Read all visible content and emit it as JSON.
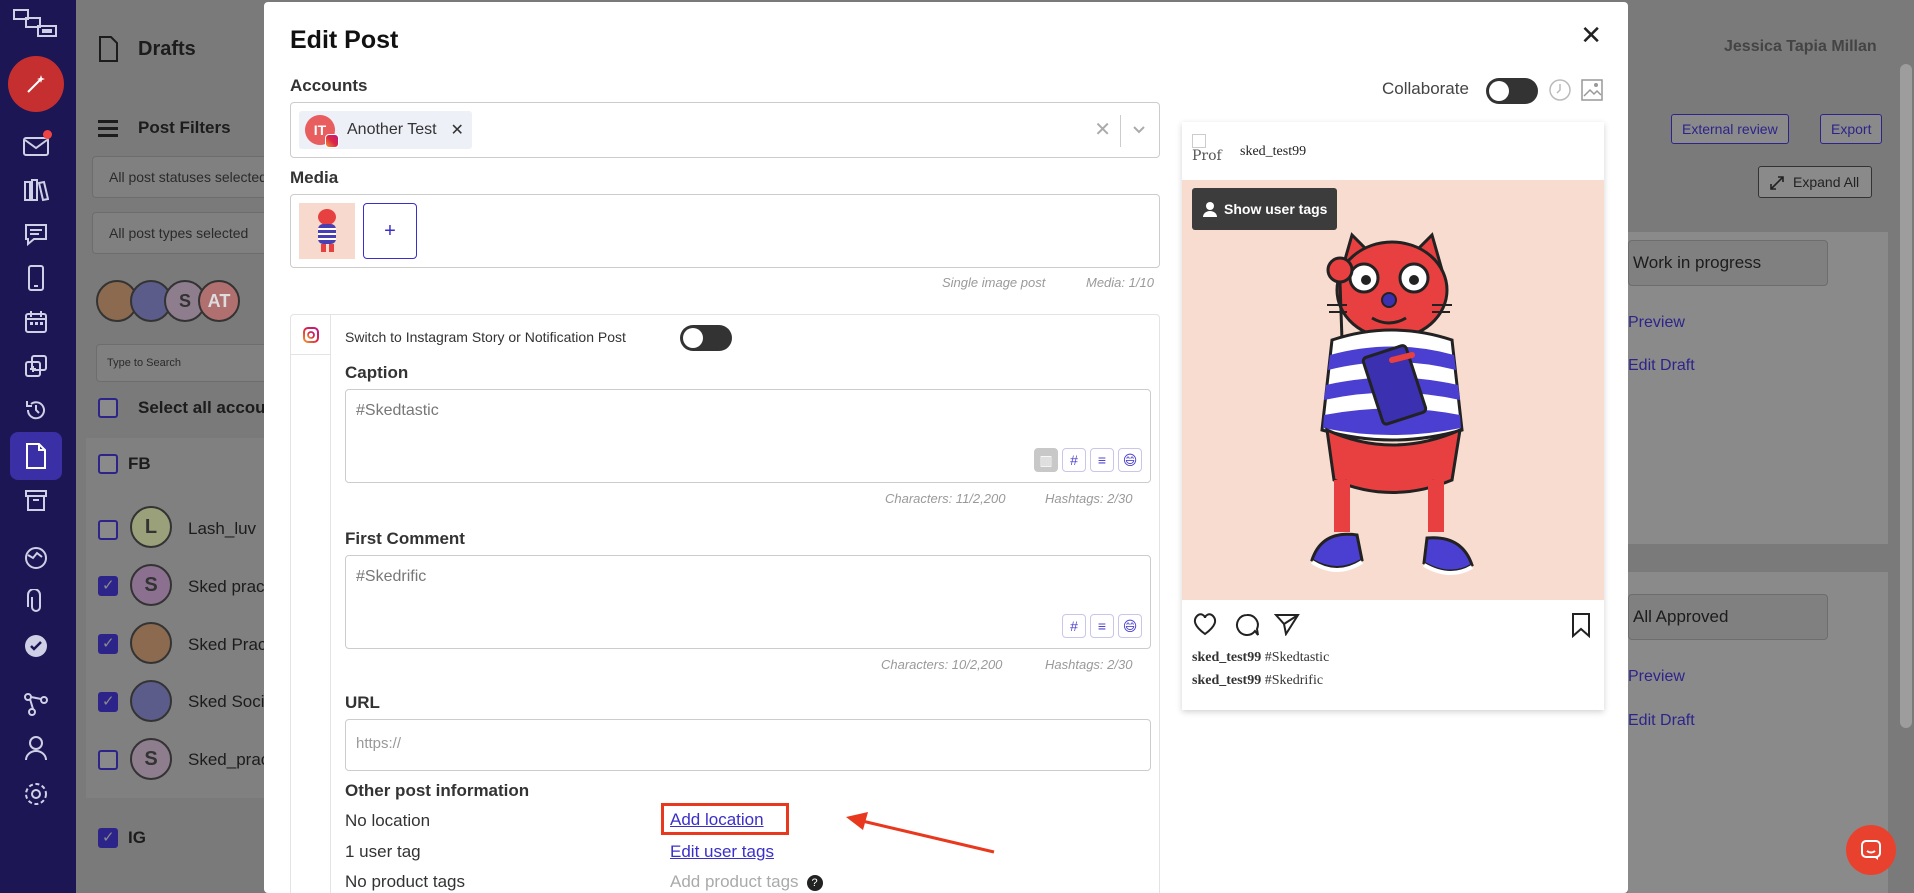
{
  "background": {
    "page_title": "Drafts",
    "user_name": "Jessica Tapia Millan",
    "post_filters_label": "Post Filters",
    "status_filter": "All post statuses selected",
    "type_filter": "All post types selected",
    "search_placeholder": "Type to Search",
    "select_all_label": "Select all accounts",
    "groups": [
      {
        "name": "FB"
      },
      {
        "name": "IG"
      }
    ],
    "accounts": [
      {
        "name": "Lash_luv",
        "initial": "L",
        "checked": false
      },
      {
        "name": "Sked practice",
        "initial": "S",
        "checked": true
      },
      {
        "name": "Sked Practice",
        "initial": "",
        "checked": true
      },
      {
        "name": "Sked Social",
        "initial": "",
        "checked": true
      },
      {
        "name": "Sked_practice",
        "initial": "S",
        "checked": false
      }
    ],
    "external_review": "External review",
    "export": "Export",
    "expand_all": "Expand All",
    "status_1": "Work in progress",
    "status_2": "All Approved",
    "preview_link": "Preview",
    "edit_draft_link": "Edit Draft"
  },
  "modal": {
    "title": "Edit Post",
    "accounts_label": "Accounts",
    "account_chip": {
      "initials": "IT",
      "name": "Another Test"
    },
    "media_label": "Media",
    "media_add": "+",
    "media_hint_type": "Single image post",
    "media_hint_count": "Media: 1/10",
    "switch_label": "Switch to Instagram Story or Notification Post",
    "caption_label": "Caption",
    "caption_value": "#Skedtastic",
    "caption_chars": "Characters: 11/2,200",
    "caption_hashtags": "Hashtags: 2/30",
    "first_comment_label": "First Comment",
    "first_comment_value": "#Skedrific",
    "comment_chars": "Characters: 10/2,200",
    "comment_hashtags": "Hashtags: 2/30",
    "url_label": "URL",
    "url_placeholder": "https://",
    "other_info_label": "Other post information",
    "location_status": "No location",
    "location_link": "Add location",
    "user_tag_status": "1 user tag",
    "user_tag_link": "Edit user tags",
    "product_tag_status": "No product tags",
    "product_tag_link": "Add product tags",
    "help": "?"
  },
  "preview": {
    "collaborate_label": "Collaborate",
    "avatar_alt": "Prof",
    "username": "sked_test99",
    "show_user_tags": "Show user tags",
    "caption_user": "sked_test99",
    "caption_text": "#Skedtastic",
    "comment_user": "sked_test99",
    "comment_text": "#Skedrific"
  },
  "colors": {
    "nav_bg": "#1d1654",
    "accent": "#3b2fc9",
    "highlight": "#e8391f",
    "compose": "#c52f2f"
  }
}
